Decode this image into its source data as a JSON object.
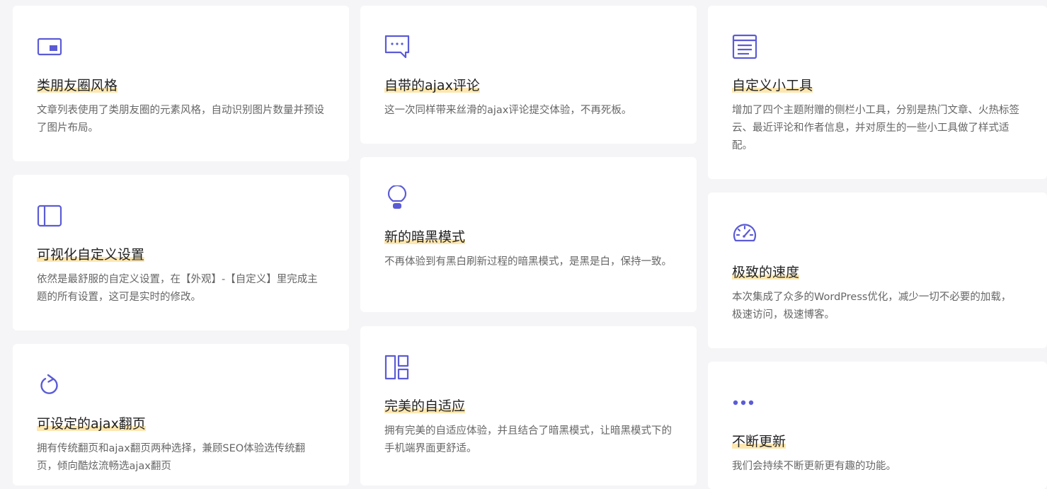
{
  "accent_color": "#5b5bd6",
  "highlight_color": "#fde7b0",
  "features": [
    {
      "key": "moments",
      "icon": "picture-in-picture-icon",
      "title": "类朋友圈风格",
      "desc": "文章列表使用了类朋友圈的元素风格，自动识别图片数量并预设了图片布局。"
    },
    {
      "key": "ajax-comment",
      "icon": "chat-bubble-icon",
      "title": "自带的ajax评论",
      "desc": "这一次同样带来丝滑的ajax评论提交体验，不再死板。"
    },
    {
      "key": "widgets",
      "icon": "document-list-icon",
      "title": "自定义小工具",
      "desc": "增加了四个主题附赠的侧栏小工具，分别是热门文章、火热标签云、最近评论和作者信息，并对原生的一些小工具做了样式适配。"
    },
    {
      "key": "customizer",
      "icon": "sidebar-layout-icon",
      "title": "可视化自定义设置",
      "desc": "依然是最舒服的自定义设置，在【外观】-【自定义】里完成主题的所有设置，这可是实时的修改。"
    },
    {
      "key": "dark-mode",
      "icon": "lightbulb-icon",
      "title": "新的暗黑模式",
      "desc": "不再体验到有黑白刷新过程的暗黑模式，是黑是白，保持一致。"
    },
    {
      "key": "speed",
      "icon": "speedometer-icon",
      "title": "极致的速度",
      "desc": "本次集成了众多的WordPress优化，减少一切不必要的加载，极速访问，极速博客。"
    },
    {
      "key": "ajax-paging",
      "icon": "refresh-icon",
      "title": "可设定的ajax翻页",
      "desc": "拥有传统翻页和ajax翻页两种选择，兼顾SEO体验选传统翻页，倾向酷炫流畅选ajax翻页"
    },
    {
      "key": "responsive",
      "icon": "layout-grid-icon",
      "title": "完美的自适应",
      "desc": "拥有完美的自适应体验，并且结合了暗黑模式，让暗黑模式下的手机端界面更舒适。"
    },
    {
      "key": "updates",
      "icon": "more-dots-icon",
      "title": "不断更新",
      "desc": "我们会持续不断更新更有趣的功能。"
    }
  ]
}
